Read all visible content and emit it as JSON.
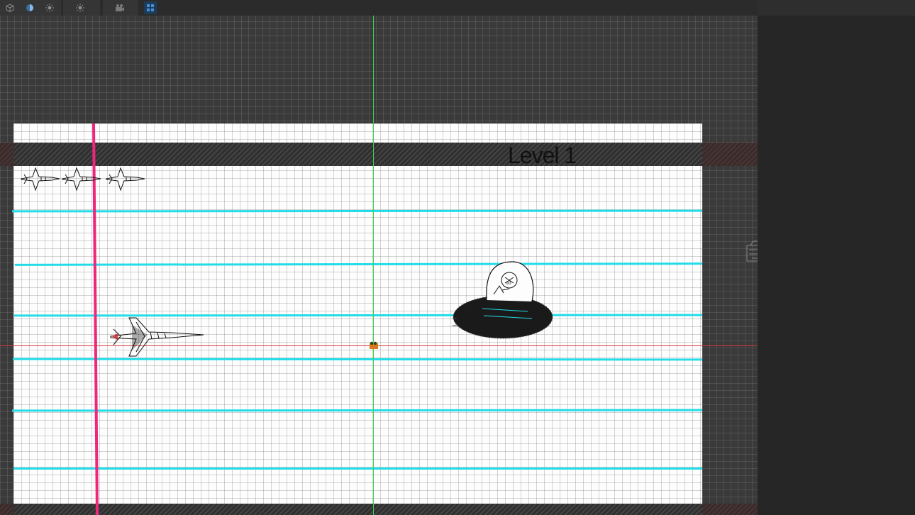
{
  "scene": {
    "level_title": "Level 1",
    "lives_remaining": 3
  },
  "toolbar": {
    "buttons": [
      {
        "name": "3d-cube-icon",
        "active": false
      },
      {
        "name": "shading-mode-icon",
        "active": false
      },
      {
        "name": "lighting-icon",
        "active": false
      },
      {
        "name": "sun-icon",
        "active": false
      },
      {
        "name": "camera-icon",
        "active": false
      },
      {
        "name": "gizmo-grid-icon",
        "active": true
      }
    ]
  },
  "colors": {
    "scene_background": "#3a3a3a",
    "paper": "#fdfdfd",
    "ruled_line": "#22dce8",
    "margin_line": "#f0267a",
    "x_axis": "#d83a3a",
    "y_axis": "#3bd44a",
    "panel": "#262626"
  },
  "sprites": {
    "player": "fighter-jet-icon",
    "enemy": "ufo-alien-icon",
    "origin": "transform-pivot-icon",
    "offscreen_object": "enemy-spawner-icon"
  }
}
